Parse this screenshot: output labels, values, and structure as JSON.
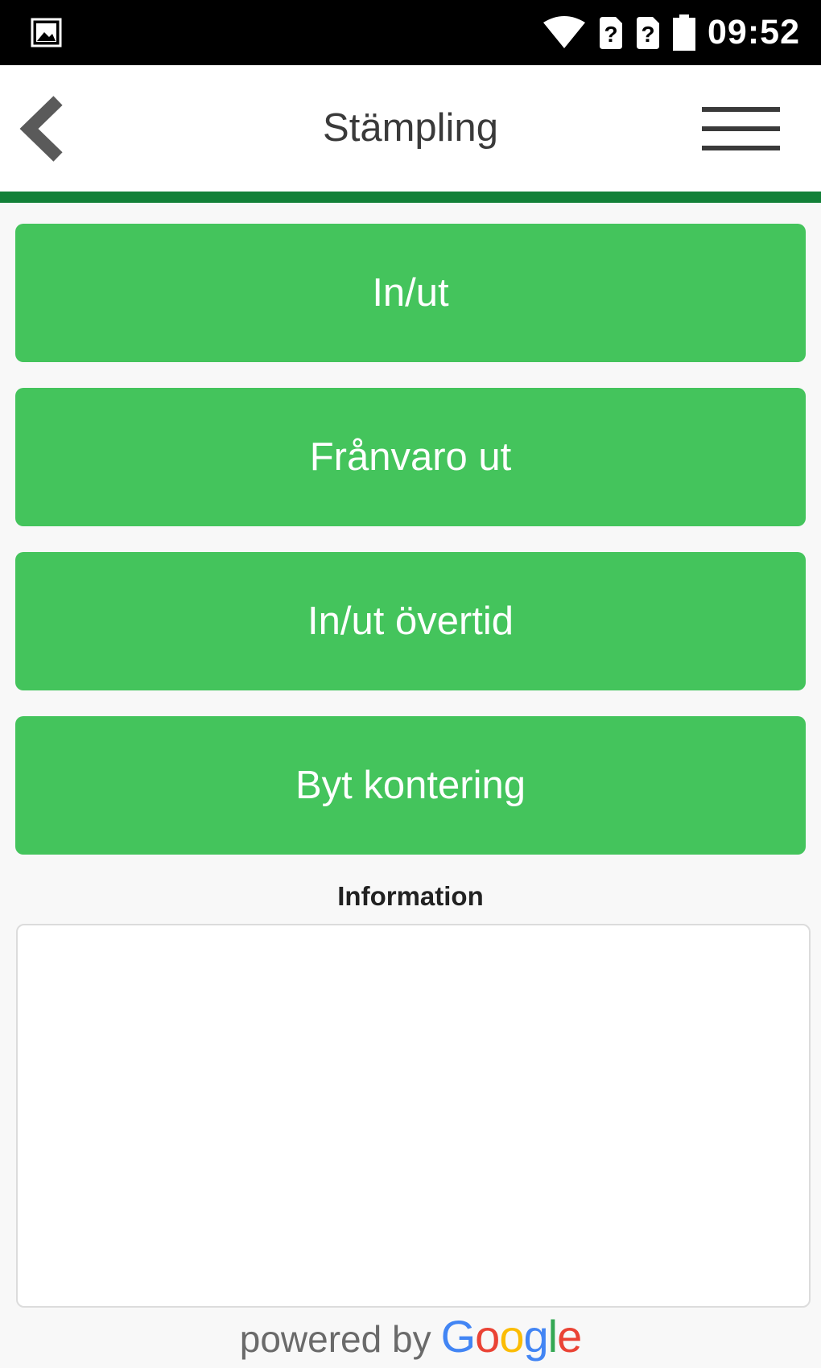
{
  "status_bar": {
    "time": "09:52",
    "icons": [
      "image-notification-icon",
      "wifi-icon",
      "no-sim-icon",
      "no-sim-icon",
      "battery-icon"
    ]
  },
  "header": {
    "title": "Stämpling",
    "back_icon": "chevron-left-icon",
    "menu_icon": "hamburger-menu-icon",
    "accent_color": "#128038"
  },
  "actions": {
    "button_color": "#44c45c",
    "items": [
      {
        "label": "In/ut"
      },
      {
        "label": "Frånvaro ut"
      },
      {
        "label": "In/ut övertid"
      },
      {
        "label": "Byt kontering"
      }
    ]
  },
  "information": {
    "label": "Information",
    "content": ""
  },
  "footer": {
    "powered_text": "powered by",
    "brand": "Google"
  }
}
